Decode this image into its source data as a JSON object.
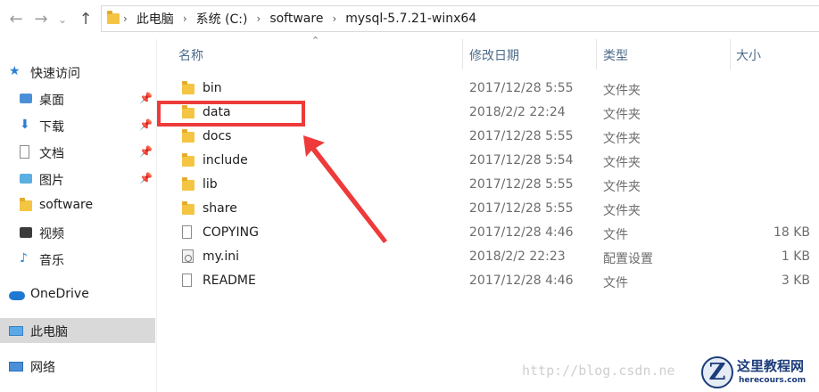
{
  "nav": {
    "back_icon": "back-arrow-icon",
    "forward_icon": "forward-arrow-icon",
    "up_icon": "up-arrow-icon"
  },
  "breadcrumb": {
    "items": [
      "此电脑",
      "系统 (C:)",
      "software",
      "mysql-5.7.21-winx64"
    ]
  },
  "sidebar": {
    "quick_access": "快速访问",
    "items": [
      {
        "label": "桌面",
        "pinned": true
      },
      {
        "label": "下载",
        "pinned": true
      },
      {
        "label": "文档",
        "pinned": true
      },
      {
        "label": "图片",
        "pinned": true
      },
      {
        "label": "software",
        "pinned": false
      },
      {
        "label": "视频",
        "pinned": false
      },
      {
        "label": "音乐",
        "pinned": false
      }
    ],
    "onedrive": "OneDrive",
    "this_pc": "此电脑",
    "network": "网络"
  },
  "columns": {
    "name": "名称",
    "date": "修改日期",
    "type": "类型",
    "size": "大小"
  },
  "files": [
    {
      "name": "bin",
      "date": "2017/12/28 5:55",
      "type": "文件夹",
      "size": "",
      "icon": "folder-icon"
    },
    {
      "name": "data",
      "date": "2018/2/2 22:24",
      "type": "文件夹",
      "size": "",
      "icon": "folder-icon"
    },
    {
      "name": "docs",
      "date": "2017/12/28 5:55",
      "type": "文件夹",
      "size": "",
      "icon": "folder-icon"
    },
    {
      "name": "include",
      "date": "2017/12/28 5:54",
      "type": "文件夹",
      "size": "",
      "icon": "folder-icon"
    },
    {
      "name": "lib",
      "date": "2017/12/28 5:55",
      "type": "文件夹",
      "size": "",
      "icon": "folder-icon"
    },
    {
      "name": "share",
      "date": "2017/12/28 5:55",
      "type": "文件夹",
      "size": "",
      "icon": "folder-icon"
    },
    {
      "name": "COPYING",
      "date": "2017/12/28 4:46",
      "type": "文件",
      "size": "18 KB",
      "icon": "file-icon"
    },
    {
      "name": "my.ini",
      "date": "2018/2/2 22:23",
      "type": "配置设置",
      "size": "1 KB",
      "icon": "settings-file-icon"
    },
    {
      "name": "README",
      "date": "2017/12/28 4:46",
      "type": "文件",
      "size": "3 KB",
      "icon": "file-icon"
    }
  ],
  "annotation": {
    "color": "#ee3a3a"
  },
  "watermark": {
    "text": "http://blog.csdn.ne"
  },
  "logo": {
    "mark": "Z",
    "name": "这里教程网",
    "url": "herecours.com"
  }
}
